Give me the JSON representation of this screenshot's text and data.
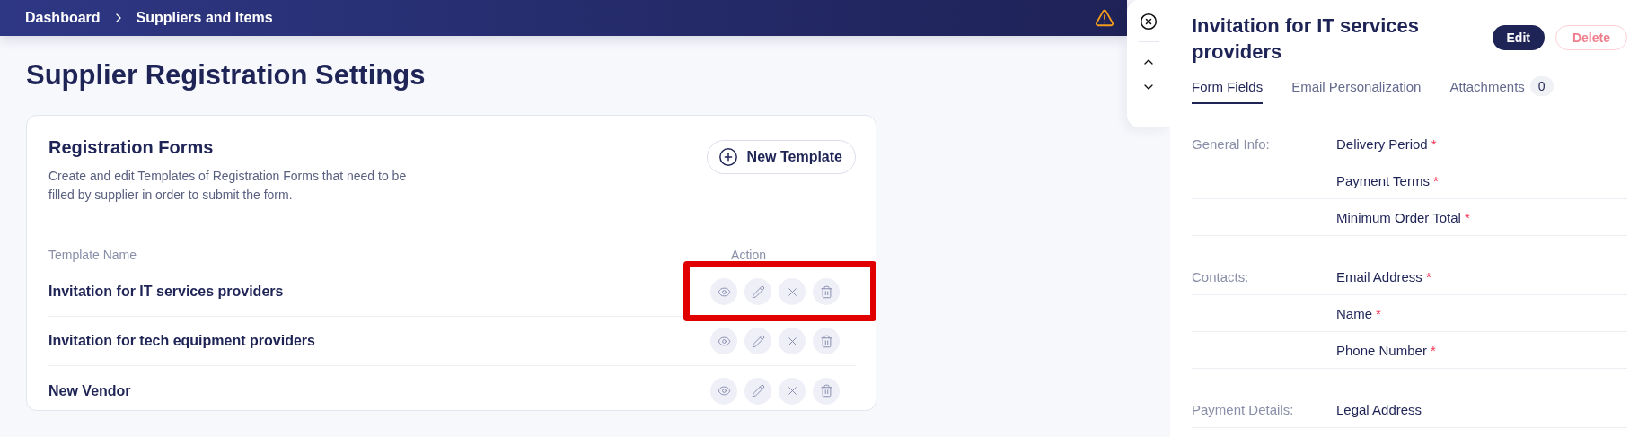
{
  "breadcrumb": [
    {
      "label": "Dashboard"
    },
    {
      "label": "Suppliers and Items"
    }
  ],
  "page_title": "Supplier Registration Settings",
  "registration_forms": {
    "title": "Registration Forms",
    "description": "Create and edit Templates of Registration Forms that need to be filled by supplier in order to submit the form.",
    "new_template_button": "New Template",
    "columns": [
      "Template Name",
      "Action"
    ],
    "rows": [
      {
        "name": "Invitation for IT services providers",
        "highlighted": true
      },
      {
        "name": "Invitation for tech equipment providers",
        "highlighted": false
      },
      {
        "name": "New Vendor",
        "highlighted": false
      }
    ]
  },
  "detail_panel": {
    "title": "Invitation for IT services providers",
    "edit_button": "Edit",
    "delete_button": "Delete",
    "tabs": [
      {
        "label": "Form Fields",
        "selected": true
      },
      {
        "label": "Email Personalization",
        "selected": false
      },
      {
        "label": "Attachments",
        "count": "0",
        "selected": false
      }
    ],
    "sections": [
      {
        "label": "General Info:",
        "fields": [
          {
            "name": "Delivery Period",
            "required_mark": "*"
          },
          {
            "name": "Payment Terms",
            "required_mark": "*"
          },
          {
            "name": "Minimum Order Total",
            "required_mark": "*"
          }
        ]
      },
      {
        "label": "Contacts:",
        "fields": [
          {
            "name": "Email Address",
            "required_mark": "*"
          },
          {
            "name": "Name",
            "required_mark": "*"
          },
          {
            "name": "Phone Number",
            "required_mark": "*"
          }
        ]
      },
      {
        "label": "Payment Details:",
        "fields": [
          {
            "name": "Legal Address"
          }
        ]
      }
    ]
  }
}
